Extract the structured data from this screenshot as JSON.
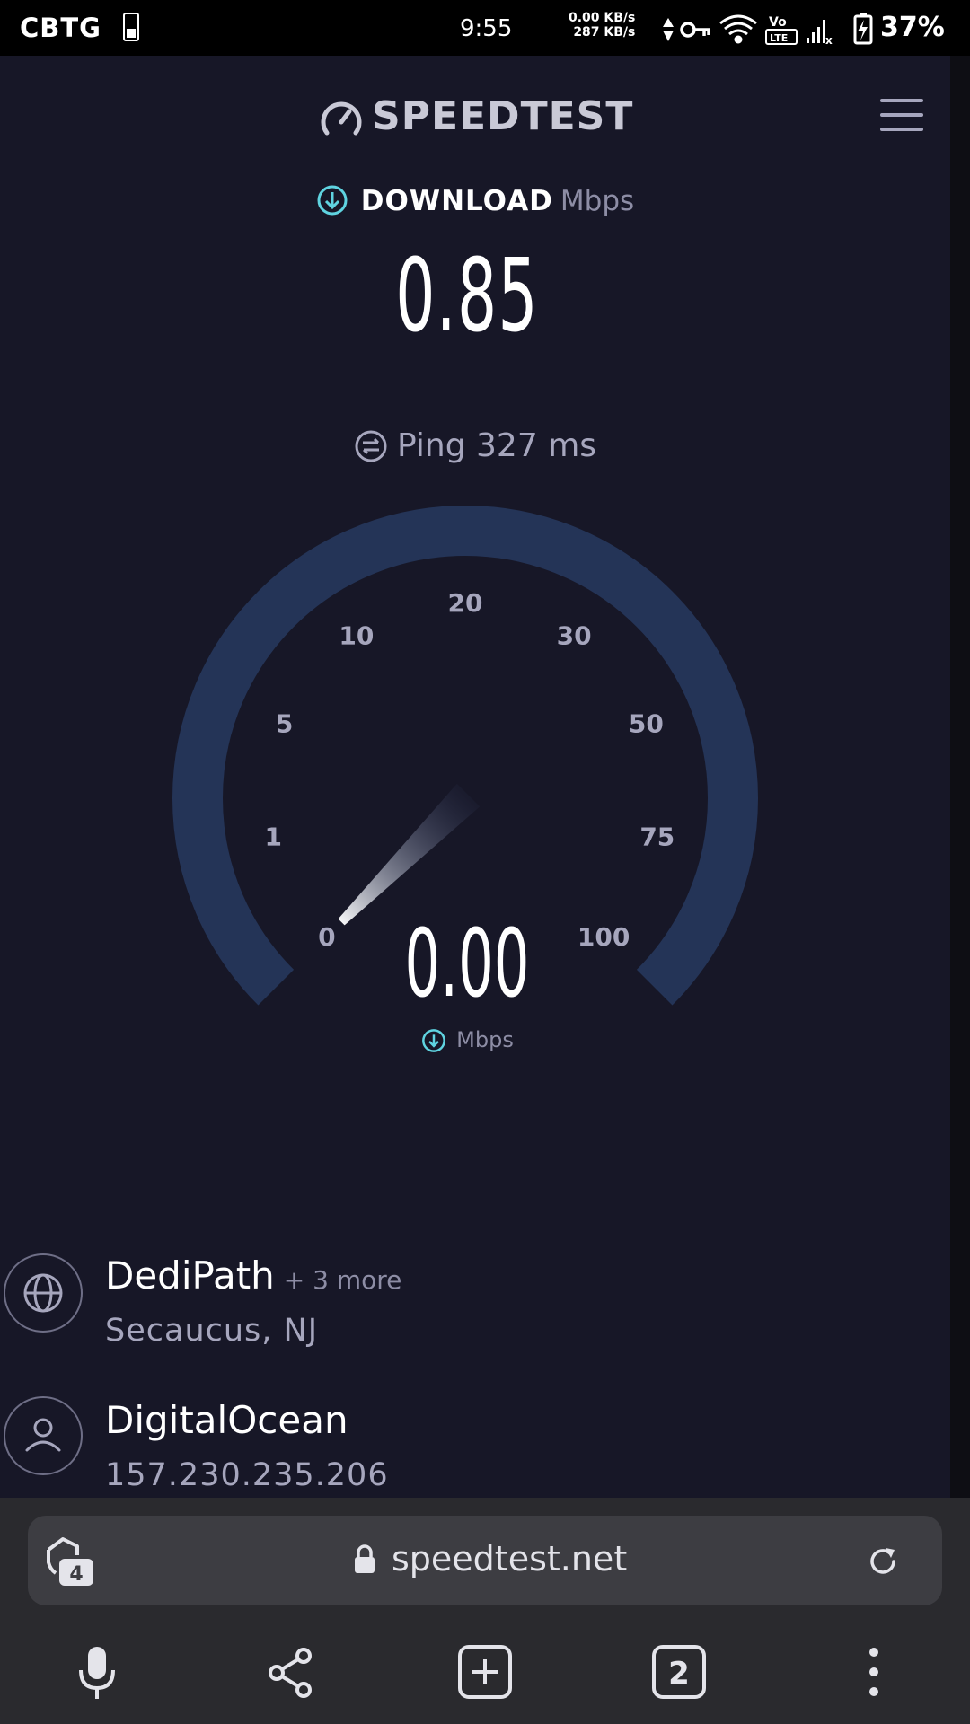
{
  "status_bar": {
    "carrier": "CBTG",
    "time": "9:55",
    "net_speed_up": "0.00 KB/s",
    "net_speed_down": "287 KB/s",
    "volte_label": "Vo",
    "lte_label": "LTE",
    "battery_percent": "37%"
  },
  "app": {
    "logo_text": "SPEEDTEST",
    "download_label": "DOWNLOAD",
    "download_unit": "Mbps",
    "download_value": "0.85",
    "ping_label": "Ping",
    "ping_value": "327",
    "ping_unit": "ms",
    "gauge": {
      "ticks": [
        "0",
        "1",
        "5",
        "10",
        "20",
        "30",
        "50",
        "75",
        "100"
      ],
      "current_value": "0.00",
      "current_unit": "Mbps",
      "track_color": "#243457",
      "needle_level": 0.0
    },
    "servers": [
      {
        "name": "DediPath",
        "more": "+ 3 more",
        "sub": "Secaucus, NJ",
        "icon": "globe-icon"
      },
      {
        "name": "DigitalOcean",
        "sub": "157.230.235.206",
        "icon": "user-icon"
      }
    ],
    "accent_color": "#5fd3e0"
  },
  "browser": {
    "url": "speedtest.net",
    "shield_count": "4",
    "tab_count": "2"
  }
}
